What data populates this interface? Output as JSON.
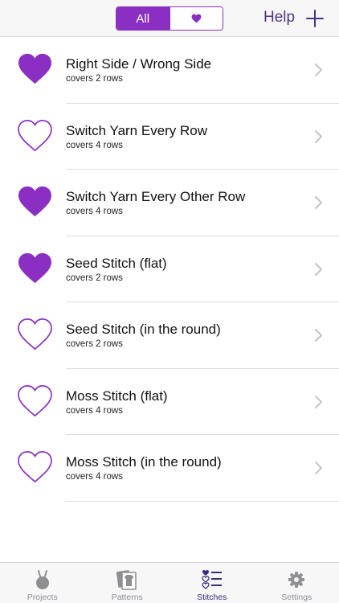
{
  "colors": {
    "accent": "#8a2fc2",
    "nav_text": "#4a3680",
    "tab_active": "#3b2b7a",
    "tab_inactive": "#8e8e93"
  },
  "header": {
    "segments": [
      {
        "label": "All",
        "selected": true
      },
      {
        "icon": "heart-icon",
        "selected": false
      }
    ],
    "help_label": "Help",
    "add_icon": "plus-icon"
  },
  "stitches": [
    {
      "title": "Right Side / Wrong Side",
      "subtitle": "covers 2 rows",
      "favorite": true
    },
    {
      "title": "Switch Yarn Every Row",
      "subtitle": "covers 4 rows",
      "favorite": false
    },
    {
      "title": "Switch Yarn Every Other Row",
      "subtitle": "covers 4 rows",
      "favorite": true
    },
    {
      "title": "Seed Stitch (flat)",
      "subtitle": "covers 2 rows",
      "favorite": true
    },
    {
      "title": "Seed Stitch (in the round)",
      "subtitle": "covers 2 rows",
      "favorite": false
    },
    {
      "title": "Moss Stitch (flat)",
      "subtitle": "covers 4 rows",
      "favorite": false
    },
    {
      "title": "Moss Stitch (in the round)",
      "subtitle": "covers 4 rows",
      "favorite": false
    }
  ],
  "tabbar": {
    "tabs": [
      {
        "label": "Projects",
        "icon": "yarn-ball-icon",
        "active": false
      },
      {
        "label": "Patterns",
        "icon": "sweater-pattern-icon",
        "active": false
      },
      {
        "label": "Stitches",
        "icon": "stitch-list-icon",
        "active": true
      },
      {
        "label": "Settings",
        "icon": "gear-icon",
        "active": false
      }
    ]
  }
}
